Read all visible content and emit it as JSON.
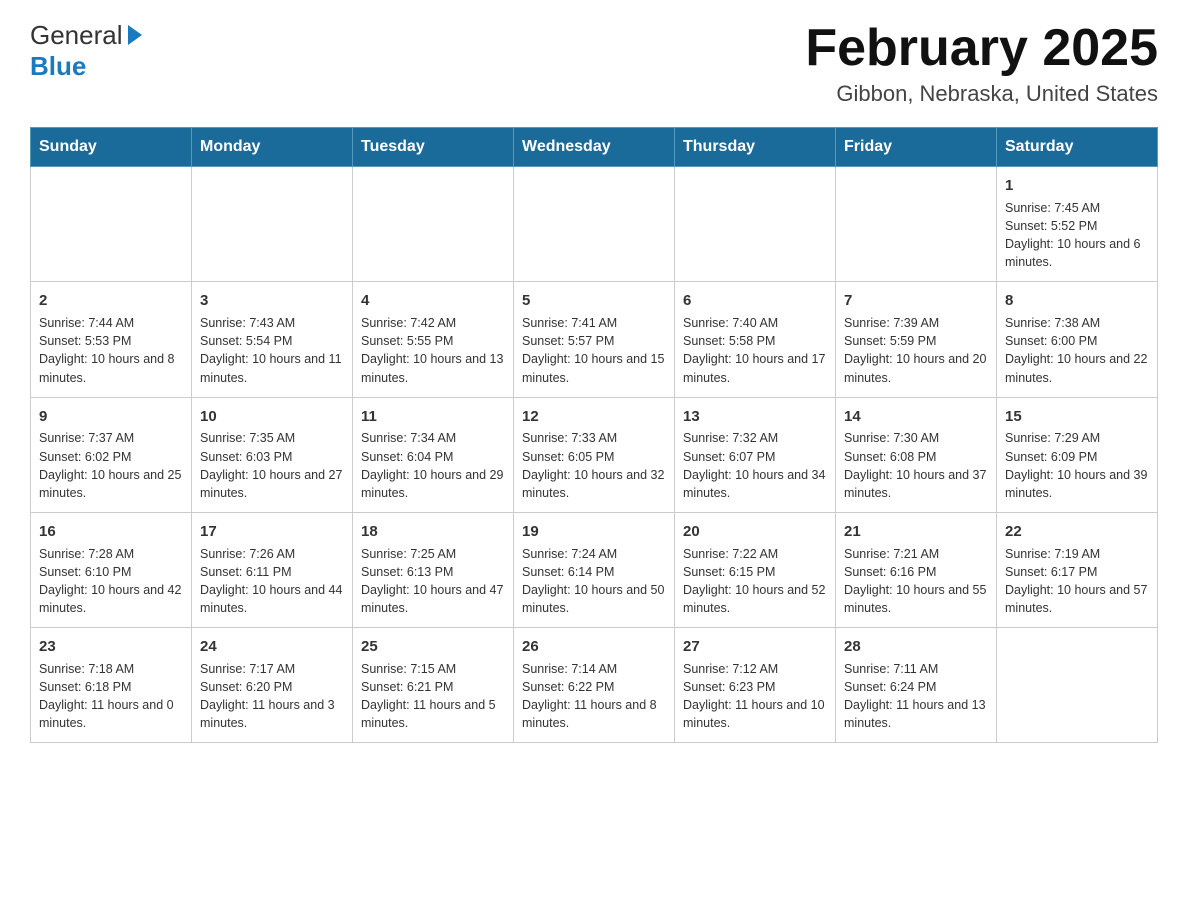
{
  "header": {
    "logo_general": "General",
    "logo_blue": "Blue",
    "month_title": "February 2025",
    "location": "Gibbon, Nebraska, United States"
  },
  "days_of_week": [
    "Sunday",
    "Monday",
    "Tuesday",
    "Wednesday",
    "Thursday",
    "Friday",
    "Saturday"
  ],
  "weeks": [
    [
      {
        "day": "",
        "info": ""
      },
      {
        "day": "",
        "info": ""
      },
      {
        "day": "",
        "info": ""
      },
      {
        "day": "",
        "info": ""
      },
      {
        "day": "",
        "info": ""
      },
      {
        "day": "",
        "info": ""
      },
      {
        "day": "1",
        "info": "Sunrise: 7:45 AM\nSunset: 5:52 PM\nDaylight: 10 hours and 6 minutes."
      }
    ],
    [
      {
        "day": "2",
        "info": "Sunrise: 7:44 AM\nSunset: 5:53 PM\nDaylight: 10 hours and 8 minutes."
      },
      {
        "day": "3",
        "info": "Sunrise: 7:43 AM\nSunset: 5:54 PM\nDaylight: 10 hours and 11 minutes."
      },
      {
        "day": "4",
        "info": "Sunrise: 7:42 AM\nSunset: 5:55 PM\nDaylight: 10 hours and 13 minutes."
      },
      {
        "day": "5",
        "info": "Sunrise: 7:41 AM\nSunset: 5:57 PM\nDaylight: 10 hours and 15 minutes."
      },
      {
        "day": "6",
        "info": "Sunrise: 7:40 AM\nSunset: 5:58 PM\nDaylight: 10 hours and 17 minutes."
      },
      {
        "day": "7",
        "info": "Sunrise: 7:39 AM\nSunset: 5:59 PM\nDaylight: 10 hours and 20 minutes."
      },
      {
        "day": "8",
        "info": "Sunrise: 7:38 AM\nSunset: 6:00 PM\nDaylight: 10 hours and 22 minutes."
      }
    ],
    [
      {
        "day": "9",
        "info": "Sunrise: 7:37 AM\nSunset: 6:02 PM\nDaylight: 10 hours and 25 minutes."
      },
      {
        "day": "10",
        "info": "Sunrise: 7:35 AM\nSunset: 6:03 PM\nDaylight: 10 hours and 27 minutes."
      },
      {
        "day": "11",
        "info": "Sunrise: 7:34 AM\nSunset: 6:04 PM\nDaylight: 10 hours and 29 minutes."
      },
      {
        "day": "12",
        "info": "Sunrise: 7:33 AM\nSunset: 6:05 PM\nDaylight: 10 hours and 32 minutes."
      },
      {
        "day": "13",
        "info": "Sunrise: 7:32 AM\nSunset: 6:07 PM\nDaylight: 10 hours and 34 minutes."
      },
      {
        "day": "14",
        "info": "Sunrise: 7:30 AM\nSunset: 6:08 PM\nDaylight: 10 hours and 37 minutes."
      },
      {
        "day": "15",
        "info": "Sunrise: 7:29 AM\nSunset: 6:09 PM\nDaylight: 10 hours and 39 minutes."
      }
    ],
    [
      {
        "day": "16",
        "info": "Sunrise: 7:28 AM\nSunset: 6:10 PM\nDaylight: 10 hours and 42 minutes."
      },
      {
        "day": "17",
        "info": "Sunrise: 7:26 AM\nSunset: 6:11 PM\nDaylight: 10 hours and 44 minutes."
      },
      {
        "day": "18",
        "info": "Sunrise: 7:25 AM\nSunset: 6:13 PM\nDaylight: 10 hours and 47 minutes."
      },
      {
        "day": "19",
        "info": "Sunrise: 7:24 AM\nSunset: 6:14 PM\nDaylight: 10 hours and 50 minutes."
      },
      {
        "day": "20",
        "info": "Sunrise: 7:22 AM\nSunset: 6:15 PM\nDaylight: 10 hours and 52 minutes."
      },
      {
        "day": "21",
        "info": "Sunrise: 7:21 AM\nSunset: 6:16 PM\nDaylight: 10 hours and 55 minutes."
      },
      {
        "day": "22",
        "info": "Sunrise: 7:19 AM\nSunset: 6:17 PM\nDaylight: 10 hours and 57 minutes."
      }
    ],
    [
      {
        "day": "23",
        "info": "Sunrise: 7:18 AM\nSunset: 6:18 PM\nDaylight: 11 hours and 0 minutes."
      },
      {
        "day": "24",
        "info": "Sunrise: 7:17 AM\nSunset: 6:20 PM\nDaylight: 11 hours and 3 minutes."
      },
      {
        "day": "25",
        "info": "Sunrise: 7:15 AM\nSunset: 6:21 PM\nDaylight: 11 hours and 5 minutes."
      },
      {
        "day": "26",
        "info": "Sunrise: 7:14 AM\nSunset: 6:22 PM\nDaylight: 11 hours and 8 minutes."
      },
      {
        "day": "27",
        "info": "Sunrise: 7:12 AM\nSunset: 6:23 PM\nDaylight: 11 hours and 10 minutes."
      },
      {
        "day": "28",
        "info": "Sunrise: 7:11 AM\nSunset: 6:24 PM\nDaylight: 11 hours and 13 minutes."
      },
      {
        "day": "",
        "info": ""
      }
    ]
  ]
}
